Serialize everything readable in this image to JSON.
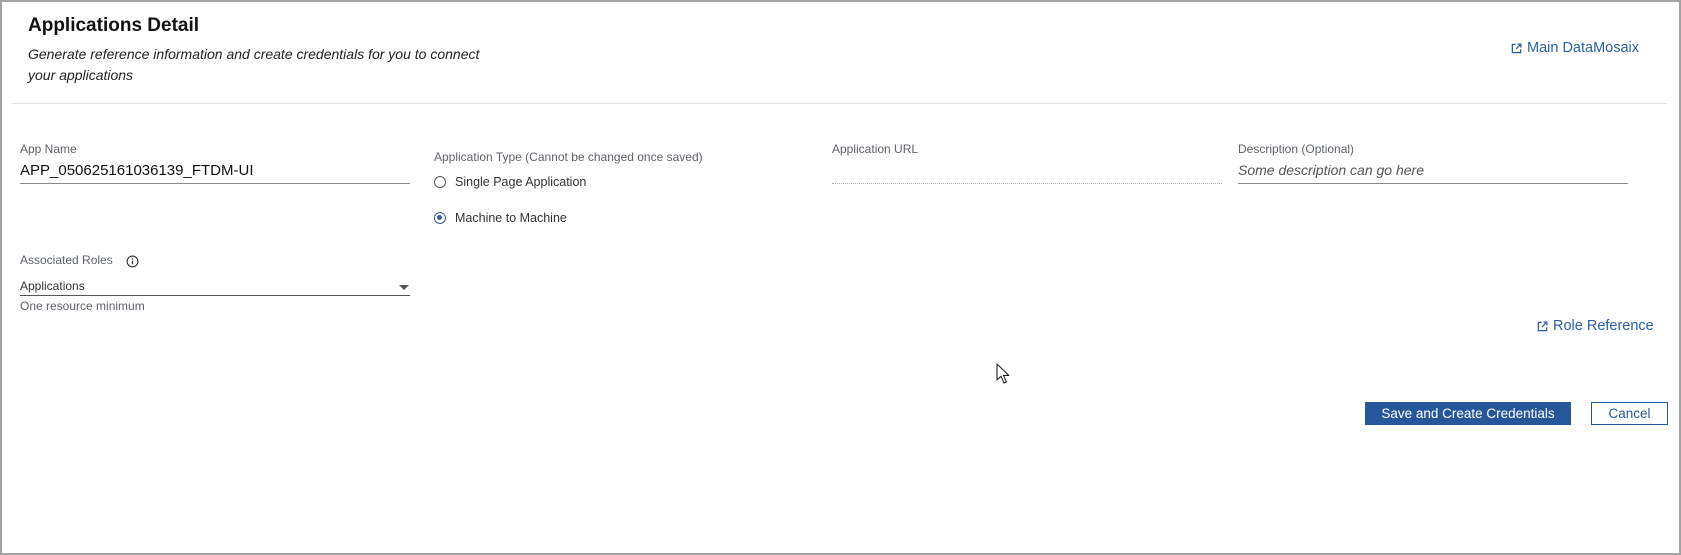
{
  "header": {
    "title": "Applications Detail",
    "subtitle": "Generate reference information and create credentials for you to connect your applications",
    "main_link": {
      "label": "Main DataMosaix",
      "icon": "external-link-icon"
    }
  },
  "form": {
    "app_name": {
      "label": "App Name",
      "value": "APP_050625161036139_FTDM-UI"
    },
    "application_type": {
      "label": "Application Type (Cannot be changed once saved)",
      "options": [
        {
          "label": "Single Page Application",
          "selected": false
        },
        {
          "label": "Machine to Machine",
          "selected": true
        }
      ]
    },
    "application_url": {
      "label": "Application URL",
      "value": ""
    },
    "description": {
      "label": "Description (Optional)",
      "placeholder": "Some description can go here"
    },
    "associated_roles": {
      "label": "Associated Roles",
      "info_icon": "info-icon",
      "selected": "Applications",
      "helper": "One resource minimum"
    }
  },
  "role_link": {
    "label": "Role Reference",
    "icon": "external-link-icon"
  },
  "actions": {
    "save_label": "Save and Create Credentials",
    "cancel_label": "Cancel"
  },
  "colors": {
    "accent": "#26579a",
    "link": "#2d5fa6",
    "frame_border": "#a3a3a3"
  }
}
